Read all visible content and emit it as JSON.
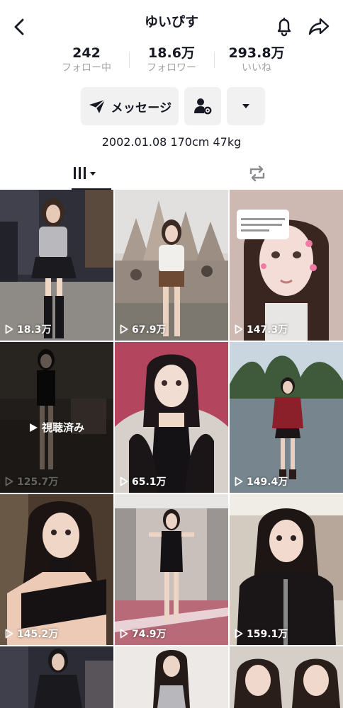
{
  "header": {
    "title": "ゆいぴす"
  },
  "stats": [
    {
      "value": "242",
      "label": "フォロー中"
    },
    {
      "value": "18.6万",
      "label": "フォロワー"
    },
    {
      "value": "293.8万",
      "label": "いいね"
    }
  ],
  "actions": {
    "message_label": "メッセージ"
  },
  "bio": "2002.01.08 170cm 47kg",
  "videos": [
    {
      "views": "18.3万"
    },
    {
      "views": "67.9万"
    },
    {
      "views": "147.3万"
    },
    {
      "views": "125.7万",
      "watched_label": "視聴済み"
    },
    {
      "views": "65.1万"
    },
    {
      "views": "149.4万"
    },
    {
      "views": "145.2万"
    },
    {
      "views": "74.9万"
    },
    {
      "views": "159.1万"
    }
  ],
  "thumb_colors": {
    "night_street": "#3a3a44",
    "castle": "#c9c2b8",
    "selfie": "#e7d4cf",
    "dark_room": "#2a2624",
    "pink_room": "#c2607a",
    "park": "#8aa0b4",
    "dim_room": "#4a3a30",
    "hallway": "#b8a7a9",
    "shop": "#d9d2c8"
  }
}
